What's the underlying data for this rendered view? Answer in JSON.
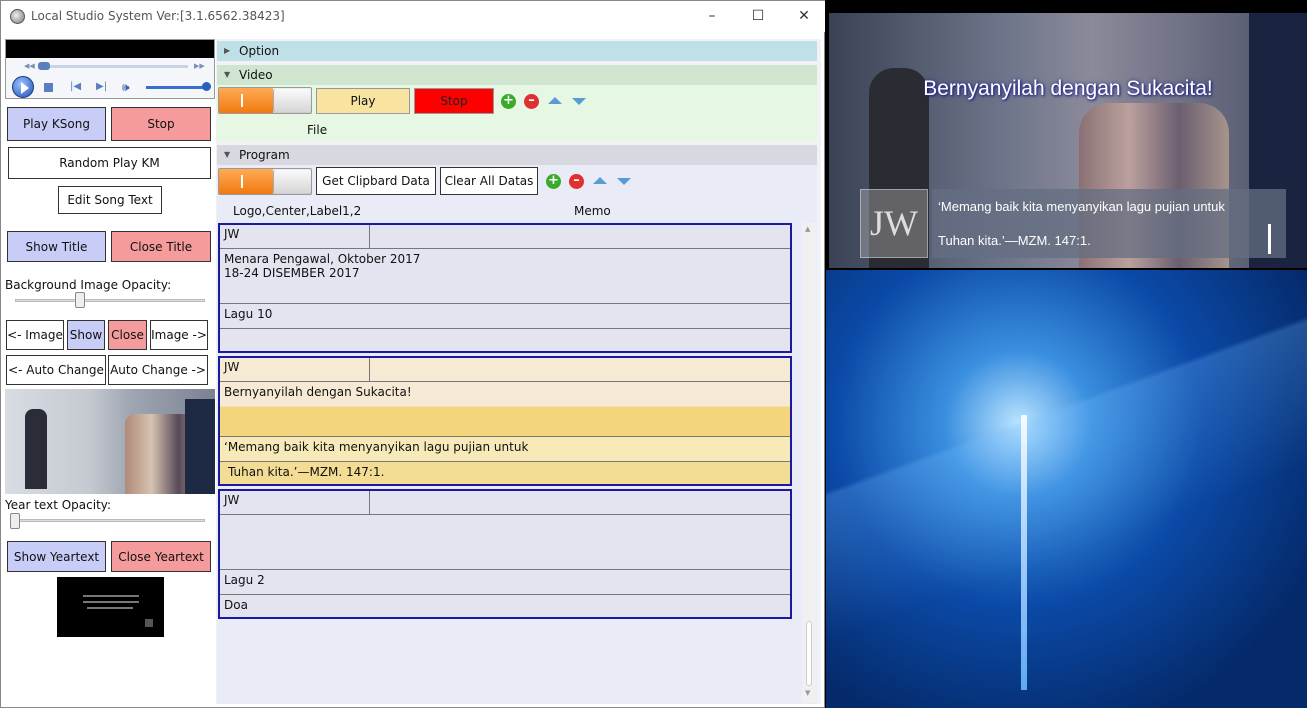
{
  "window": {
    "title": "Local Studio System Ver:[3.1.6562.38423]",
    "min_icon": "minimize-icon",
    "max_icon": "maximize-icon",
    "close_icon": "close-icon"
  },
  "left": {
    "play_ksong": "Play KSong",
    "stop": "Stop",
    "random_play": "Random Play KM",
    "edit_song_text": "Edit Song Text",
    "show_title": "Show Title",
    "close_title": "Close Title",
    "bg_opacity_label": "Background Image Opacity:",
    "bg_opacity_value": 0.35,
    "prev_image": "<- Image",
    "show": "Show",
    "close": "Close",
    "next_image": "Image ->",
    "auto_change_back": "<- Auto Change",
    "auto_change_fwd": "Auto Change ->",
    "year_opacity_label": "Year text Opacity:",
    "year_opacity_value": 0.0,
    "show_yeartext": "Show Yeartext",
    "close_yeartext": "Close Yeartext"
  },
  "sections": {
    "option": "Option",
    "video": "Video",
    "program": "Program"
  },
  "video": {
    "play": "Play",
    "stop": "Stop",
    "file_label": "File"
  },
  "program": {
    "get_clipboard": "Get Clipbard Data",
    "clear_all": "Clear All Datas",
    "col_logo": "Logo,Center,Label1,2",
    "col_memo": "Memo",
    "groups": [
      {
        "logo": "JW",
        "memo": "",
        "line1": "Menara Pengawal, Oktober 2017",
        "line1b": "18-24 DISEMBER 2017",
        "label1": "Lagu 10",
        "label2": ""
      },
      {
        "logo": "JW",
        "memo": "",
        "line1": "Bernyanyilah dengan Sukacita!",
        "line1b": "",
        "label1": "‘Memang baik kita menyanyikan lagu pujian untuk",
        "label2": "Tuhan kita.’—MZM. 147:1."
      },
      {
        "logo": "JW",
        "memo": "",
        "line1": "",
        "line1b": "",
        "label1": "Lagu 2",
        "label2": "Doa"
      }
    ]
  },
  "preview": {
    "title": "Bernyanyilah dengan Sukacita!",
    "logo": "JW",
    "line1": "‘Memang baik kita menyanyikan lagu pujian untuk",
    "line2": "Tuhan kita.’—MZM. 147:1."
  },
  "colors": {
    "section_option": "#bfe0e6",
    "section_video": "#cfe5cf",
    "section_program": "#d8d8e0",
    "video_bg": "#e6f7e4",
    "play_yellow": "#f8e4a0",
    "stop_red": "#ff0000",
    "selected_group": "#f5e6b8"
  }
}
